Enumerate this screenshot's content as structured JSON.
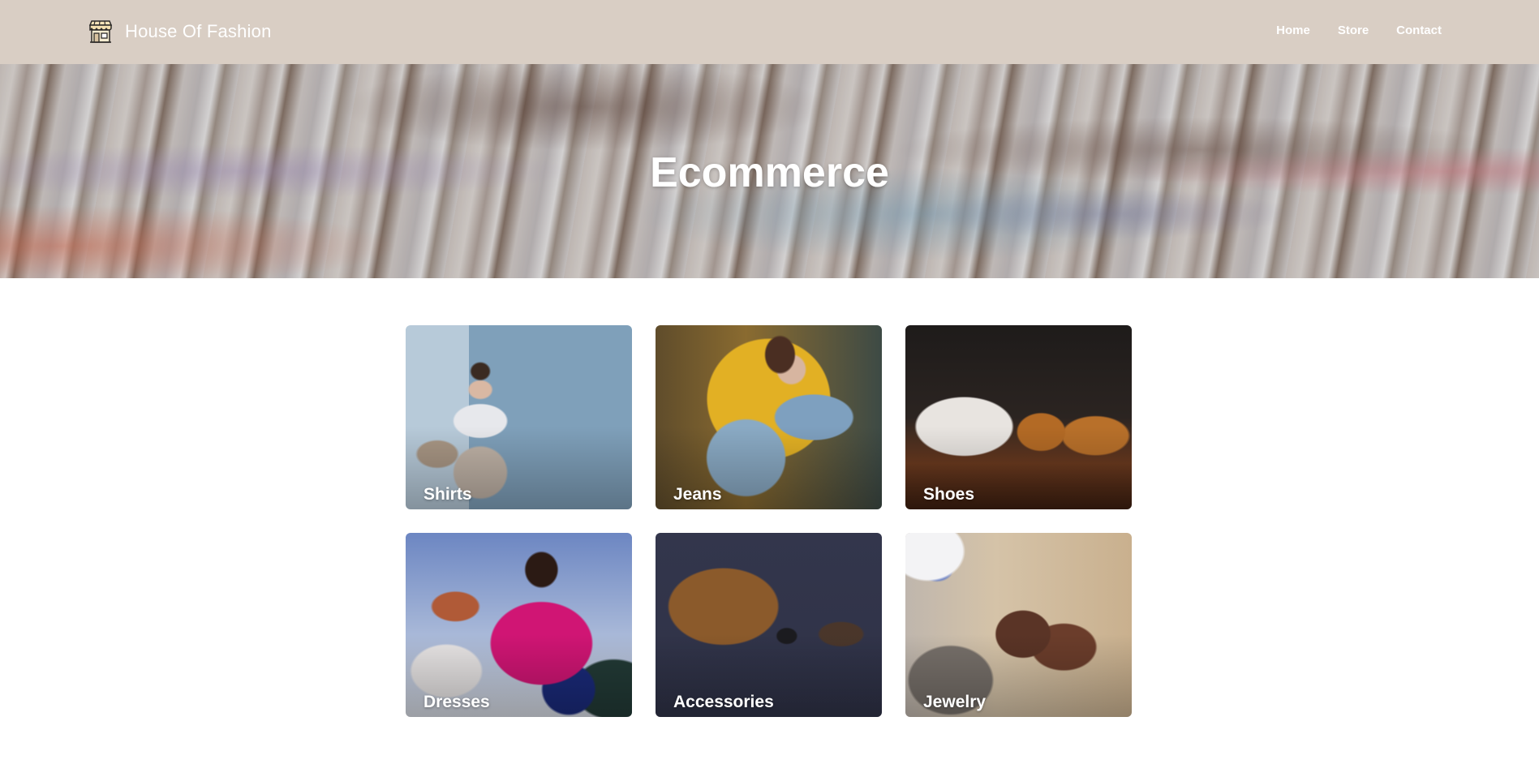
{
  "navbar": {
    "brand_title": "House Of Fashion",
    "brand_icon": "storefront-icon",
    "links": [
      {
        "label": "Home"
      },
      {
        "label": "Store"
      },
      {
        "label": "Contact"
      }
    ]
  },
  "hero": {
    "title": "Ecommerce"
  },
  "categories": [
    {
      "label": "Shirts"
    },
    {
      "label": "Jeans"
    },
    {
      "label": "Shoes"
    },
    {
      "label": "Dresses"
    },
    {
      "label": "Accessories"
    },
    {
      "label": "Jewelry"
    }
  ],
  "colors": {
    "navbar_bg": "#d9cec4",
    "page_bg": "#ffffff",
    "text_on_dark": "#ffffff"
  }
}
